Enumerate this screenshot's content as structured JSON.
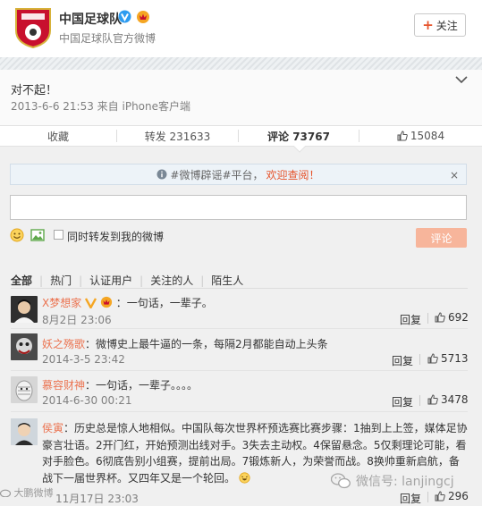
{
  "header": {
    "account_name": "中国足球队",
    "account_desc": "中国足球队官方微博",
    "follow_label": "关注"
  },
  "post": {
    "text": "对不起！",
    "meta": "2013-6-6 21:53 来自 iPhone客户端"
  },
  "tabs": {
    "favorite": "收藏",
    "repost": "转发 231633",
    "comment": "评论 73767",
    "like": "15084"
  },
  "notice": {
    "prefix": "#微博辟谣#平台，",
    "accent": "欢迎查阅！",
    "close": "×"
  },
  "composer": {
    "input_value": "",
    "repost_label": "同时转发到我的微博",
    "submit_label": "评论"
  },
  "filters": [
    "全部",
    "热门",
    "认证用户",
    "关注的人",
    "陌生人"
  ],
  "comments": [
    {
      "user": "X梦想家",
      "text": "：一句话，一辈子。",
      "time": "8月2日 23:06",
      "reply": "回复",
      "likes": "692"
    },
    {
      "user": "妖之殇歌",
      "text": "：微博史上最牛逼的一条，每隔2月都能自动上头条",
      "time": "2014-3-5 23:42",
      "reply": "回复",
      "likes": "5713"
    },
    {
      "user": "慕容财神",
      "text": "：一句话，一辈子。。。。",
      "time": "2014-6-30 00:21",
      "reply": "回复",
      "likes": "3478"
    },
    {
      "user": "侯寅",
      "text": "：历史总是惊人地相似。中国队每次世界杯预选赛比赛步骤：1抽到上上签，媒体足协豪言壮语。2开门红，开始预测出线对手。3失去主动权。4保留悬念。5仅剩理论可能，看对手脸色。6彻底告别小组赛，提前出局。7锻炼新人，为荣誉而战。8换帅重新启航，备战下一届世界杯。又四年又是一个轮回。",
      "time": "11月17日 23:03",
      "reply": "回复",
      "likes": "296"
    }
  ],
  "watermarks": {
    "left": "大鹏微博",
    "right": "微信号: lanjingcj"
  },
  "colors": {
    "accent": "#eb7350",
    "submit_bg": "#f7b59b",
    "notice_bg": "#edf3f8",
    "gray_bg": "#f0f0f0"
  }
}
